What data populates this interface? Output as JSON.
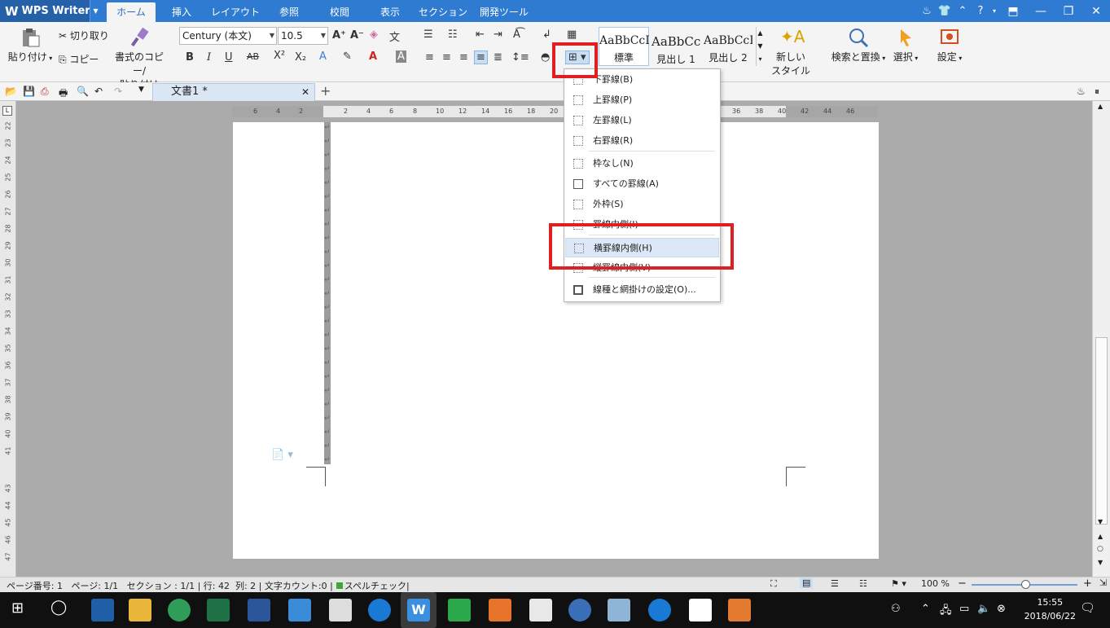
{
  "app": {
    "name": "WPS Writer",
    "logo": "W"
  },
  "menu_tabs": [
    "ホーム",
    "挿入",
    "レイアウト",
    "参照",
    "校閲",
    "表示",
    "セクション",
    "開発ツール"
  ],
  "ribbon": {
    "paste": "貼り付け",
    "cut": "切り取り",
    "copy": "コピー",
    "format_painter_line1": "書式のコピー/",
    "format_painter_line2": "貼り付け",
    "font_name": "Century (本文)",
    "font_size": "10.5",
    "styles": [
      {
        "sample": "AaBbCcI",
        "label": "標準"
      },
      {
        "sample": "AaBbCc",
        "label": "見出し 1"
      },
      {
        "sample": "AaBbCcD",
        "label": "見出し 2"
      }
    ],
    "new_style_line1": "新しい",
    "new_style_line2": "スタイル",
    "find_replace": "検索と置換",
    "select": "選択",
    "settings": "設定"
  },
  "doc_tab": {
    "title": "文書1 *"
  },
  "border_menu": {
    "items": [
      "下罫線(B)",
      "上罫線(P)",
      "左罫線(L)",
      "右罫線(R)",
      "枠なし(N)",
      "すべての罫線(A)",
      "外枠(S)",
      "罫線内側(I)",
      "横罫線内側(H)",
      "縦罫線内側(V)",
      "線種と網掛けの設定(O)..."
    ],
    "highlighted_index": 8
  },
  "hruler_numbers": [
    "6",
    "4",
    "2",
    "2",
    "4",
    "6",
    "8",
    "10",
    "12",
    "14",
    "16",
    "18",
    "20",
    "36",
    "38",
    "40",
    "42",
    "44",
    "46"
  ],
  "vruler_numbers": [
    "22",
    "23",
    "24",
    "25",
    "26",
    "27",
    "28",
    "29",
    "30",
    "31",
    "32",
    "33",
    "34",
    "35",
    "36",
    "37",
    "38",
    "39",
    "40",
    "41",
    "43",
    "44",
    "45",
    "46",
    "47"
  ],
  "status": {
    "page_num": "ページ番号: 1",
    "pages": "ページ: 1/1",
    "section": "セクション : 1/1",
    "line": "行: 42",
    "col": "列: 2",
    "char_count": "文字カウント:0",
    "spell": "スペルチェック",
    "zoom": "100 %"
  },
  "taskbar": {
    "time": "15:55",
    "date": "2018/06/22"
  },
  "colors": {
    "accent": "#2E7BD1",
    "annotation": "#E02020",
    "highlight": "#DCE8F7"
  }
}
